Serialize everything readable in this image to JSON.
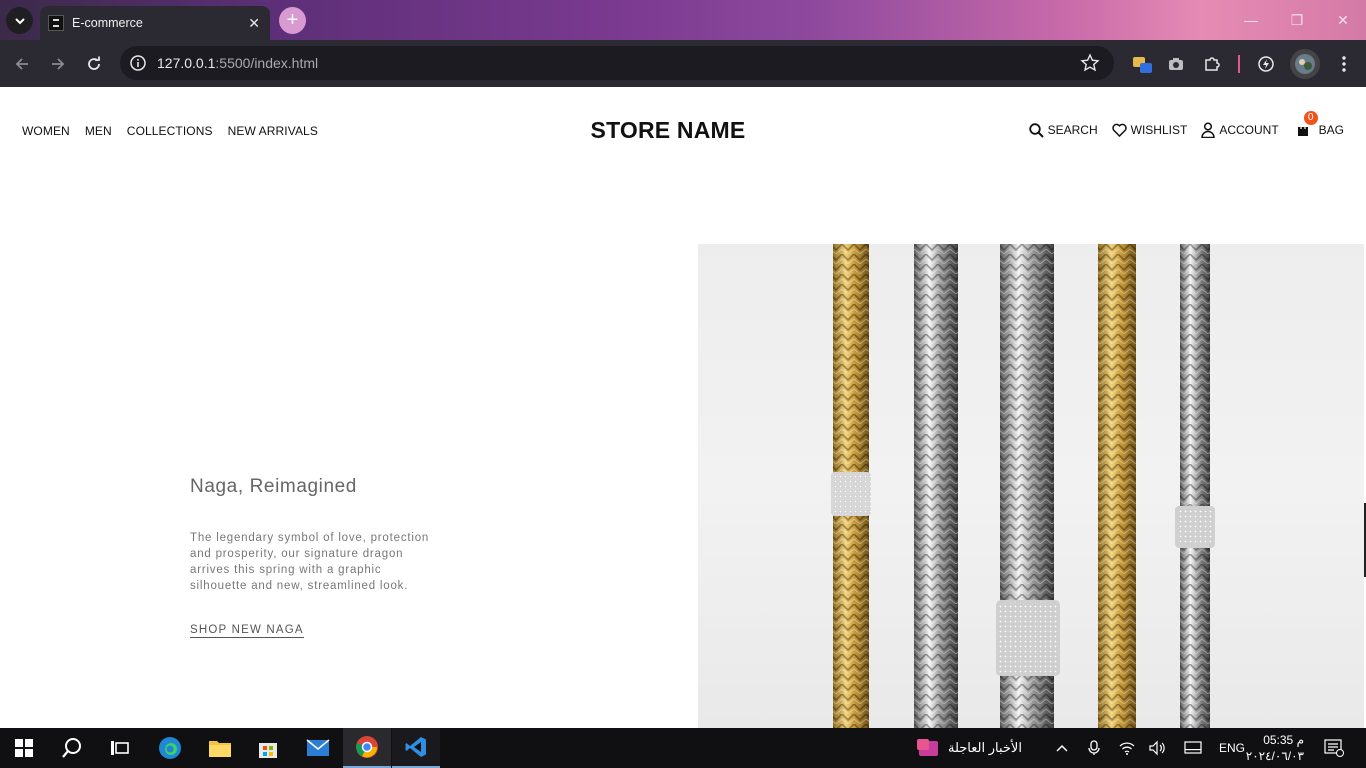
{
  "browser": {
    "tab_title": "E-commerce",
    "url_host": "127.0.0.1",
    "url_rest": ":5500/index.html"
  },
  "site": {
    "nav": [
      "WOMEN",
      "MEN",
      "COLLECTIONS",
      "NEW ARRIVALS"
    ],
    "logo": "STORE NAME",
    "utility": {
      "search": "SEARCH",
      "wishlist": "WISHLIST",
      "account": "ACCOUNT",
      "bag": "BAG",
      "bag_count": "0"
    }
  },
  "hero": {
    "title": "Naga, Reimagined",
    "description": "The legendary symbol of love, protection and prosperity, our signature dragon arrives this spring with a graphic silhouette and new, streamlined look.",
    "cta": "SHOP NEW NAGA"
  },
  "taskbar": {
    "news": "الأخبار العاجلة",
    "lang": "ENG",
    "time": "05:35 م",
    "date": "٢٠٢٤/٠٦/٠٣"
  },
  "colors": {
    "accent_badge": "#f0531c",
    "chrome_bg": "#2b2a33"
  }
}
